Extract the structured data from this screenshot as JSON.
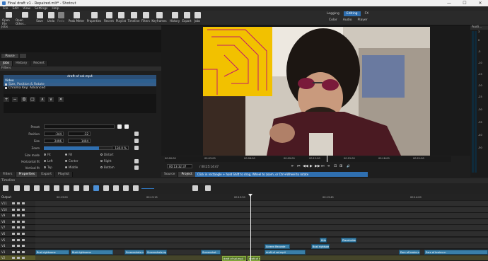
{
  "window": {
    "title": "Final draft v1 - Repaired.mlt* - Shotcut",
    "minimize": "—",
    "maximize": "☐",
    "close": "✕"
  },
  "menu": [
    "File",
    "Edit",
    "View",
    "Settings",
    "Help"
  ],
  "toolbar": {
    "buttons": [
      "Open File",
      "Open Other...",
      "Save",
      "Undo",
      "Redo",
      "Peak Meter",
      "Properties",
      "Recent",
      "Playlist",
      "Timeline",
      "Filters",
      "Keyframes",
      "History",
      "Export",
      "Jobs"
    ],
    "workspaces": [
      "Logging",
      "Editing",
      "FX"
    ],
    "workspace_active": "Editing",
    "sub_panels": [
      "Color",
      "Audio",
      "Player"
    ]
  },
  "jobs": {
    "title": "Jobs",
    "pause_label": "Pause",
    "menu_icon": "≡"
  },
  "left_tabs_top": [
    "Jobs",
    "History",
    "Recent"
  ],
  "left_tabs_top_active": "Jobs",
  "filters": {
    "title": "Filters",
    "clip_name": "draft of sol.mp4",
    "list_header": "Video",
    "items": [
      {
        "label": "Size, Position & Rotate",
        "selected": true
      },
      {
        "label": "Chroma Key: Advanced",
        "selected": false
      }
    ],
    "buttons": [
      "+",
      "−",
      "⧉",
      "▢",
      "∧",
      "∨",
      "✕"
    ],
    "preset_label": "Preset",
    "position_label": "Position",
    "position_x": "-344",
    "position_y": "-32",
    "size_label": "Size",
    "size_w": "2496",
    "size_h": "1404",
    "zoom_label": "Zoom",
    "zoom_value": "130.0 %",
    "zoom_fraction": 0.65,
    "size_mode_label": "Size mode",
    "size_modes": [
      "Fit",
      "Fill",
      "Distort"
    ],
    "size_mode_selected": "Fill",
    "hfit_label": "Horizontal fit",
    "hfit_options": [
      "Left",
      "Center",
      "Right"
    ],
    "hfit_selected": "Center",
    "vfit_label": "Vertical fit",
    "vfit_options": [
      "Top",
      "Middle",
      "Bottom"
    ],
    "vfit_selected": "Middle"
  },
  "left_tabs_bottom": [
    "Filters",
    "Properties",
    "Export",
    "Playlist"
  ],
  "left_tabs_bottom_active": "Properties",
  "viewer": {
    "ruler_labels": [
      "00:00:00",
      "00:03:00",
      "00:06:00",
      "00:09:00",
      "00:12:00",
      "00:15:00",
      "00:18:00",
      "00:21:00"
    ],
    "timecode_current": "00:13:32:37",
    "timecode_total": "/ 00:25:14:47",
    "transport": [
      "⇤",
      "⏮",
      "◀◀",
      "▶",
      "▶▶",
      "⏭",
      "⇥",
      "⊡",
      "⊞",
      "🔊"
    ],
    "tabs": [
      "Source",
      "Project"
    ],
    "tab_active": "Project",
    "hint": "Click in rectangle + hold Shift to drag, Wheel to zoom, or Ctrl+Wheel to rotate"
  },
  "audio": {
    "title": "Audi...",
    "db_labels": [
      "3",
      "0",
      "-5",
      "-10",
      "-15",
      "-20",
      "-25",
      "-30",
      "-35",
      "-40",
      "-50"
    ]
  },
  "timeline": {
    "title": "Timeline",
    "output_label": "Output",
    "ruler": [
      "00:13:00",
      "00:13:15",
      "00:13:30",
      "00:13:45",
      "00:14:00"
    ],
    "tracks": [
      "V11",
      "V10",
      "V9",
      "V8",
      "V7",
      "V6",
      "V5",
      "V4",
      "V3",
      "V2",
      "V1"
    ],
    "clips": [
      {
        "track": 7,
        "label": "title",
        "sel": false
      },
      {
        "track": 7,
        "label": "Placeholder",
        "sel": false
      },
      {
        "track": 8,
        "label": "Screen Recorde",
        "sel": false
      },
      {
        "track": 8,
        "label": "Bust rightsome",
        "sel": false
      },
      {
        "track": 9,
        "label": "Bust rightsome",
        "sel": false
      },
      {
        "track": 9,
        "label": "Bust rightsome",
        "sel": false
      },
      {
        "track": 9,
        "label": "Screenshots.mp4",
        "sel": false
      },
      {
        "track": 9,
        "label": "Screenshots.mp4",
        "sel": false
      },
      {
        "track": 9,
        "label": "Screenshot",
        "sel": false
      },
      {
        "track": 9,
        "label": "draft of sol.mp4",
        "sel": false
      },
      {
        "track": 9,
        "label": "Ears of brains.m",
        "sel": false
      },
      {
        "track": 9,
        "label": "Ears of brains.m",
        "sel": false
      },
      {
        "track": 10,
        "label": "draft of sol.mp4",
        "sel": true
      },
      {
        "track": 10,
        "label": "draft of sol.mp4",
        "sel": true
      },
      {
        "track": 11,
        "label": "draft of sol.mp4",
        "sel": false
      },
      {
        "track": 11,
        "label": "draft of sol.mp4",
        "sel": false
      }
    ]
  }
}
